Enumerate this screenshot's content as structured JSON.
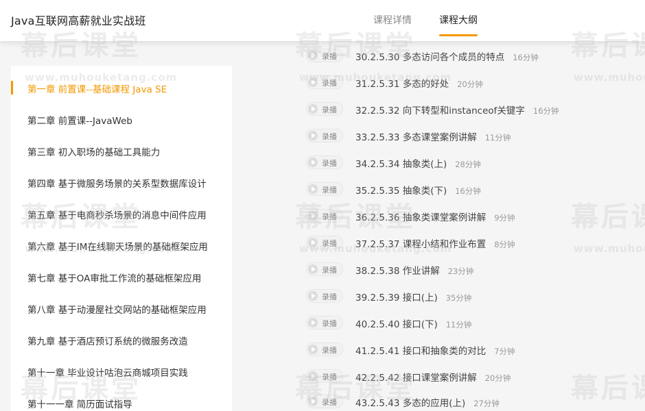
{
  "header": {
    "course_title": "Java互联网高薪就业实战班",
    "tabs": [
      {
        "label": "课程详情",
        "active": false
      },
      {
        "label": "课程大纲",
        "active": true
      }
    ]
  },
  "colors": {
    "accent": "#f39800",
    "background": "#f5f5f5",
    "panel": "#ffffff",
    "muted_text": "#999999"
  },
  "sidebar": {
    "chapters": [
      {
        "label": "第一章 前置课--基础课程 Java SE",
        "active": true
      },
      {
        "label": "第二章 前置课--JavaWeb",
        "active": false
      },
      {
        "label": "第三章 初入职场的基础工具能力",
        "active": false
      },
      {
        "label": "第四章 基于微服务场景的关系型数据库设计",
        "active": false
      },
      {
        "label": "第五章 基于电商秒杀场景的消息中间件应用",
        "active": false
      },
      {
        "label": "第六章 基于IM在线聊天场景的基础框架应用",
        "active": false
      },
      {
        "label": "第七章 基于OA审批工作流的基础框架应用",
        "active": false
      },
      {
        "label": "第八章 基于动漫屋社交网站的基础框架应用",
        "active": false
      },
      {
        "label": "第九章 基于酒店预订系统的微服务改造",
        "active": false
      },
      {
        "label": "第十一章 毕业设计咕泡云商城项目实践",
        "active": false
      },
      {
        "label": "第十一一章 简历面试指导",
        "active": false
      }
    ]
  },
  "lessons": {
    "badge_label": "录播",
    "badge_icon": "play-icon",
    "items": [
      {
        "title": "30.2.5.30 多态访问各个成员的特点",
        "duration": "16分钟"
      },
      {
        "title": "31.2.5.31 多态的好处",
        "duration": "20分钟"
      },
      {
        "title": "32.2.5.32 向下转型和instanceof关键字",
        "duration": "16分钟"
      },
      {
        "title": "33.2.5.33 多态课堂案例讲解",
        "duration": "11分钟"
      },
      {
        "title": "34.2.5.34 抽象类(上)",
        "duration": "28分钟"
      },
      {
        "title": "35.2.5.35 抽象类(下)",
        "duration": "16分钟"
      },
      {
        "title": "36.2.5.36 抽象类课堂案例讲解",
        "duration": "9分钟"
      },
      {
        "title": "37.2.5.37 课程小结和作业布置",
        "duration": "8分钟"
      },
      {
        "title": "38.2.5.38 作业讲解",
        "duration": "23分钟"
      },
      {
        "title": "39.2.5.39 接口(上)",
        "duration": "35分钟"
      },
      {
        "title": "40.2.5.40 接口(下)",
        "duration": "11分钟"
      },
      {
        "title": "41.2.5.41 接口和抽象类的对比",
        "duration": "7分钟"
      },
      {
        "title": "42.2.5.42 接口课堂案例讲解",
        "duration": "20分钟"
      },
      {
        "title": "43.2.5.43 多态的应用(上)",
        "duration": "27分钟"
      }
    ]
  },
  "watermark": {
    "main": "幕后课堂",
    "url": "www.muhouketang.com"
  }
}
